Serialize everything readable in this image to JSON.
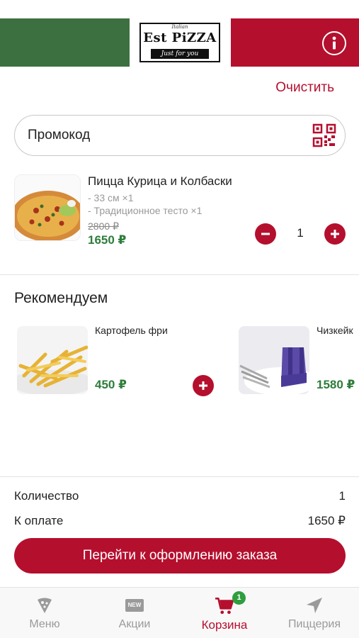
{
  "header": {
    "logo_top": "Italian",
    "logo_main": "Est PiZZA",
    "logo_sub": "Just for you",
    "info_icon": "info-icon"
  },
  "actions": {
    "clear_label": "Очистить"
  },
  "promo": {
    "placeholder": "Промокод",
    "value": "",
    "qr_icon": "qr-code-icon"
  },
  "cart_item": {
    "name": "Пицца Курица и Колбаски",
    "options": [
      "- 33 см ×1",
      "- Традиционное тесто ×1"
    ],
    "old_price": "2800 ₽",
    "price": "1650 ₽",
    "quantity": "1"
  },
  "recommend": {
    "title": "Рекомендуем",
    "items": [
      {
        "name": "Картофель фри",
        "price": "450 ₽"
      },
      {
        "name": "Чизкейк",
        "price": "1580 ₽"
      }
    ]
  },
  "summary": {
    "qty_label": "Количество",
    "qty_value": "1",
    "pay_label": "К оплате",
    "pay_value": "1650 ₽"
  },
  "checkout": {
    "label": "Перейти к оформлению заказа"
  },
  "tabbar": {
    "tabs": [
      {
        "label": "Меню",
        "icon": "pizza-slice-icon"
      },
      {
        "label": "Акции",
        "icon": "new-badge-icon",
        "icon_text": "NEW"
      },
      {
        "label": "Корзина",
        "icon": "cart-icon",
        "badge": "1"
      },
      {
        "label": "Пиццерия",
        "icon": "location-arrow-icon"
      }
    ],
    "active_index": 2
  },
  "colors": {
    "brand_red": "#b50f2e",
    "flag_green": "#3c7040",
    "price_green": "#2e7d3b",
    "badge_green": "#2e9e3e"
  }
}
